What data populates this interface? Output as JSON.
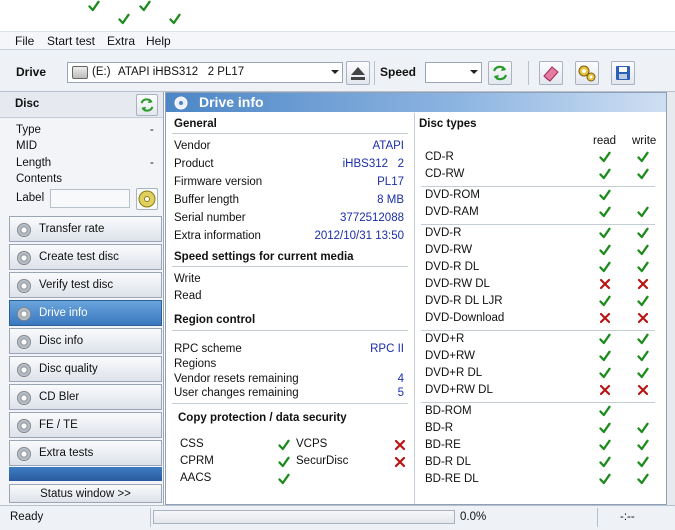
{
  "menu": {
    "file": "File",
    "start_test": "Start test",
    "extra": "Extra",
    "help": "Help"
  },
  "toolbar": {
    "drive_label": "Drive",
    "drive_letter": "(E:)",
    "drive_name": "ATAPI iHBS312   2 PL17",
    "speed_label": "Speed",
    "speed_value": ""
  },
  "disc_panel": {
    "title": "Disc",
    "type_label": "Type",
    "type_value": "-",
    "mid_label": "MID",
    "length_label": "Length",
    "length_value": "-",
    "contents_label": "Contents",
    "label_label": "Label",
    "label_value": ""
  },
  "nav": [
    "Transfer rate",
    "Create test disc",
    "Verify test disc",
    "Drive info",
    "Disc info",
    "Disc quality",
    "CD Bler",
    "FE / TE",
    "Extra tests"
  ],
  "status_window_button": "Status window >>",
  "main": {
    "header": "Drive info",
    "general": {
      "title": "General",
      "rows": [
        {
          "label": "Vendor",
          "value": "ATAPI"
        },
        {
          "label": "Product",
          "value": "iHBS312   2"
        },
        {
          "label": "Firmware version",
          "value": "PL17"
        },
        {
          "label": "Buffer length",
          "value": "8 MB"
        },
        {
          "label": "Serial number",
          "value": "3772512088"
        },
        {
          "label": "Extra information",
          "value": "2012/10/31 13:50"
        }
      ]
    },
    "speed": {
      "title": "Speed settings for current media",
      "write": "Write",
      "read": "Read"
    },
    "region": {
      "title": "Region control",
      "rows": [
        {
          "label": "RPC scheme",
          "value": "RPC II"
        },
        {
          "label": "Regions",
          "value": ""
        },
        {
          "label": "Vendor resets remaining",
          "value": "4"
        },
        {
          "label": "User changes remaining",
          "value": "5"
        }
      ]
    },
    "copy": {
      "title": "Copy protection / data security",
      "items": [
        {
          "label": "CSS",
          "ok": true
        },
        {
          "label": "VCPS",
          "ok": false
        },
        {
          "label": "CPRM",
          "ok": true
        },
        {
          "label": "SecurDisc",
          "ok": false
        },
        {
          "label": "AACS",
          "ok": true
        }
      ]
    },
    "disc_types": {
      "title": "Disc types",
      "read_label": "read",
      "write_label": "write",
      "groups": [
        [
          {
            "name": "CD-R",
            "read": true,
            "write": true
          },
          {
            "name": "CD-RW",
            "read": true,
            "write": true
          }
        ],
        [
          {
            "name": "DVD-ROM",
            "read": true,
            "write": null
          },
          {
            "name": "DVD-RAM",
            "read": true,
            "write": true
          }
        ],
        [
          {
            "name": "DVD-R",
            "read": true,
            "write": true
          },
          {
            "name": "DVD-RW",
            "read": true,
            "write": true
          },
          {
            "name": "DVD-R DL",
            "read": true,
            "write": true
          },
          {
            "name": "DVD-RW DL",
            "read": false,
            "write": false
          },
          {
            "name": "DVD-R DL LJR",
            "read": true,
            "write": true
          },
          {
            "name": "DVD-Download",
            "read": false,
            "write": false
          }
        ],
        [
          {
            "name": "DVD+R",
            "read": true,
            "write": true
          },
          {
            "name": "DVD+RW",
            "read": true,
            "write": true
          },
          {
            "name": "DVD+R DL",
            "read": true,
            "write": true
          },
          {
            "name": "DVD+RW DL",
            "read": false,
            "write": false
          }
        ],
        [
          {
            "name": "BD-ROM",
            "read": true,
            "write": null
          },
          {
            "name": "BD-R",
            "read": true,
            "write": true
          },
          {
            "name": "BD-RE",
            "read": true,
            "write": true
          },
          {
            "name": "BD-R DL",
            "read": true,
            "write": true
          },
          {
            "name": "BD-RE DL",
            "read": true,
            "write": true
          }
        ]
      ]
    }
  },
  "status": {
    "text": "Ready",
    "progress_text": "0.0%",
    "progress": 0,
    "time": "-:--"
  },
  "colors": {
    "ok": "#1e8b1e",
    "fail": "#b81414",
    "value_blue": "#1a2ea8",
    "active_nav": "#3a78bf"
  }
}
